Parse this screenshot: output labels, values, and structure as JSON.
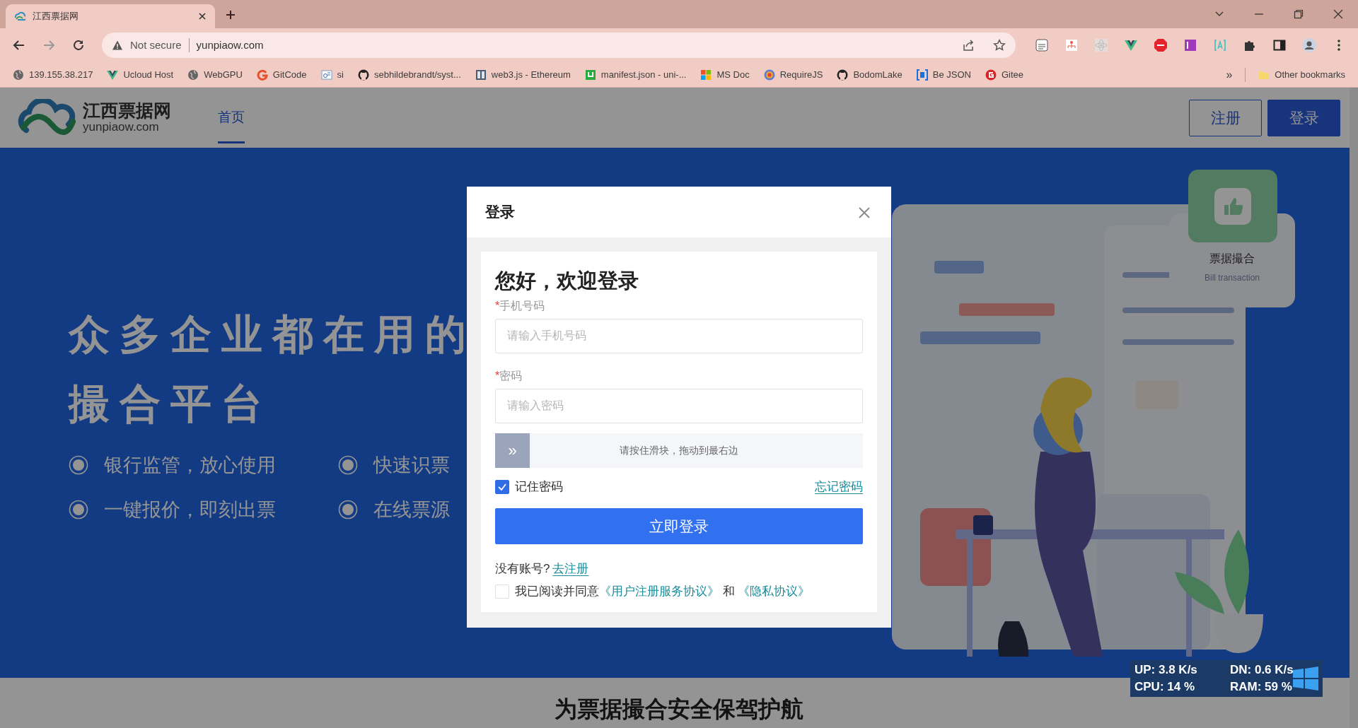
{
  "browser": {
    "tab": {
      "title": "江西票据网"
    },
    "address_bar": {
      "security": "Not secure",
      "url": "yunpiaow.com"
    },
    "bookmarks": [
      {
        "label": "139.155.38.217"
      },
      {
        "label": "Ucloud Host"
      },
      {
        "label": "WebGPU"
      },
      {
        "label": "GitCode"
      },
      {
        "label": "si"
      },
      {
        "label": "sebhildebrandt/syst..."
      },
      {
        "label": "web3.js - Ethereum"
      },
      {
        "label": "manifest.json - uni-..."
      },
      {
        "label": "MS Doc"
      },
      {
        "label": "RequireJS"
      },
      {
        "label": "BodomLake"
      },
      {
        "label": "Be JSON"
      },
      {
        "label": "Gitee"
      }
    ],
    "overflow": "»",
    "other_bookmarks": "Other bookmarks"
  },
  "site": {
    "logo": {
      "name": "江西票据网",
      "domain": "yunpiaow.com"
    },
    "nav": [
      {
        "label": "首页",
        "selected": true
      }
    ],
    "buttons": [
      {
        "label": "注册",
        "kind": "outline"
      },
      {
        "label": "登录",
        "kind": "primary"
      }
    ]
  },
  "hero": {
    "title_lines": [
      "众多企业都在用的",
      "撮合平台"
    ],
    "features": [
      "银行监管，放心使用",
      "快速识票",
      "一键报价，即刻出票",
      "在线票源"
    ],
    "card": {
      "title": "票据撮合",
      "subtitle": "Bill transaction"
    }
  },
  "section_title": "为票据撮合安全保驾护航",
  "modal": {
    "title": "登录",
    "heading": "您好，欢迎登录",
    "fields": [
      {
        "mark": "*",
        "label": "手机号码",
        "placeholder": "请输入手机号码"
      },
      {
        "mark": "*",
        "label": "密码",
        "placeholder": "请输入密码"
      }
    ],
    "slider": {
      "handle": "»",
      "hint": "请按住滑块，拖动到最右边",
      "level": 0
    },
    "remember": {
      "label": "记住密码",
      "checked": true
    },
    "forgot": "忘记密码",
    "submit": "立即登录",
    "register_prompt": "没有账号?",
    "register_link": "去注册",
    "agreement": {
      "checked": false,
      "text": "我已阅读并同意",
      "link1": "《用户注册服务协议》",
      "and": "和",
      "link2": "《隐私协议》"
    }
  },
  "net_monitor": {
    "up": "UP: 3.8 K/s",
    "down": "DN: 0.6 K/s",
    "cpu": "CPU: 14 %",
    "ram": "RAM: 59 %"
  }
}
